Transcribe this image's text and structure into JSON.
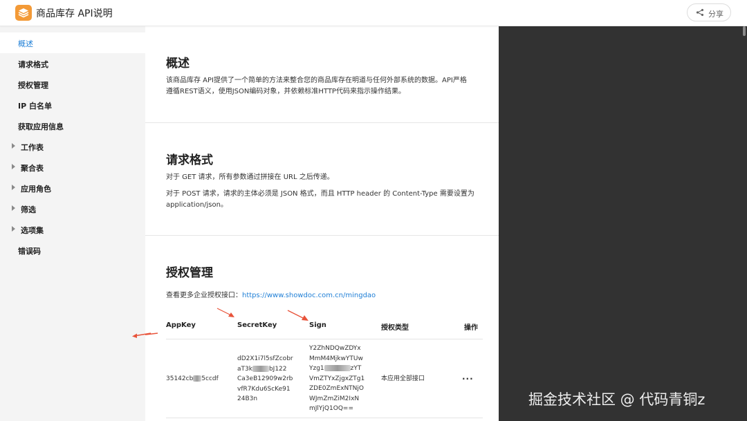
{
  "app": {
    "title": "商品库存 API说明",
    "share_label": "分享"
  },
  "sidebar": {
    "items": [
      {
        "label": "概述",
        "active": true
      },
      {
        "label": "请求格式"
      },
      {
        "label": "授权管理"
      },
      {
        "label": "IP 白名单"
      },
      {
        "label": "获取应用信息"
      },
      {
        "label": "工作表",
        "expandable": true
      },
      {
        "label": "聚合表",
        "expandable": true
      },
      {
        "label": "应用角色",
        "expandable": true
      },
      {
        "label": "筛选",
        "expandable": true
      },
      {
        "label": "选项集",
        "expandable": true
      },
      {
        "label": "错误码"
      }
    ]
  },
  "sections": {
    "overview": {
      "title": "概述",
      "body_line1": "该商品库存 API提供了一个简单的方法来整合您的商品库存在明道与任何外部系统的数据。API严格",
      "body_line2": "遵循REST语义，使用JSON编码对象，并依赖标准HTTP代码来指示操作结果。"
    },
    "request_format": {
      "title": "请求格式",
      "get_text": "对于 GET 请求，所有参数通过拼接在 URL 之后传递。",
      "post_line1": "对于 POST 请求，请求的主体必须是 JSON 格式，而且 HTTP header 的 Content-Type 需要设置为",
      "post_line2": "application/json。"
    },
    "auth": {
      "title": "授权管理",
      "more_prefix": "查看更多企业授权接口：",
      "more_link": "https://www.showdoc.com.cn/mingdao",
      "columns": {
        "appkey": "AppKey",
        "secret": "SecretKey",
        "sign": "Sign",
        "type": "授权类型",
        "ops": "操作"
      },
      "row": {
        "appkey_start": "35142cb",
        "appkey_end": "5ccdf",
        "secret_l1_start": "dD2X1i7l5sfZcobr",
        "secret_l2_start": "aT3k",
        "secret_l2_end": "bJ122",
        "secret_rest": "Ca3eB12909w2rb\nvfR7Kdu6ScKe91\n24B3n",
        "sign_l1": "Y2ZhNDQwZDYx",
        "sign_l2": "MmM4MjkwYTUw",
        "sign_l3_start": "Yzg1",
        "sign_l3_end": "zYT",
        "sign_rest": "VmZTYxZjgxZTg1\nZDE0ZmExNTNjO\nWJmZmZiM2IxN\nmJlYjQ1OQ==",
        "type": "本应用全部接口",
        "ops": "···"
      }
    }
  },
  "watermark": "掘金技术社区 @ 代码青铜z",
  "colors": {
    "accent_blue": "#1f7fd6",
    "logo_orange": "#f39a37",
    "arrow_red": "#e8533a",
    "dark_pane": "#323232"
  }
}
